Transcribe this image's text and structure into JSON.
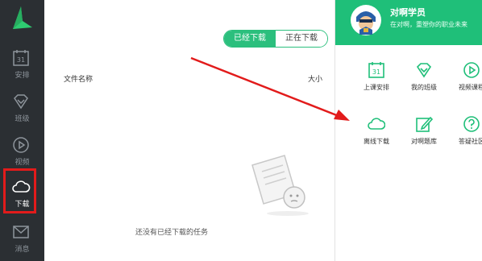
{
  "sidebar": {
    "items": [
      {
        "label": "安排",
        "icon": "calendar-icon",
        "day": "31"
      },
      {
        "label": "班级",
        "icon": "diamond-icon"
      },
      {
        "label": "视频",
        "icon": "play-icon"
      },
      {
        "label": "下载",
        "icon": "cloud-icon",
        "active": true
      },
      {
        "label": "消息",
        "icon": "mail-icon"
      }
    ]
  },
  "main": {
    "tabs": [
      {
        "label": "已经下载",
        "selected": true
      },
      {
        "label": "正在下载",
        "selected": false
      }
    ],
    "columns": {
      "name": "文件名称",
      "size": "大小"
    },
    "empty_text": "还没有已经下载的任务"
  },
  "panel": {
    "user_name": "对啊学员",
    "slogan": "在对啊，重塑你的职业未来",
    "grid": [
      {
        "label": "上课安排",
        "icon": "calendar-icon",
        "day": "31"
      },
      {
        "label": "我的班级",
        "icon": "diamond-icon"
      },
      {
        "label": "视频课程",
        "icon": "play-icon"
      },
      {
        "label": "离线下载",
        "icon": "cloud-icon"
      },
      {
        "label": "对啊题库",
        "icon": "edit-icon"
      },
      {
        "label": "答疑社区",
        "icon": "question-icon"
      }
    ]
  },
  "colors": {
    "accent": "#1fbf79",
    "sidebar_bg": "#2b2f33",
    "highlight": "#e21b1b"
  }
}
